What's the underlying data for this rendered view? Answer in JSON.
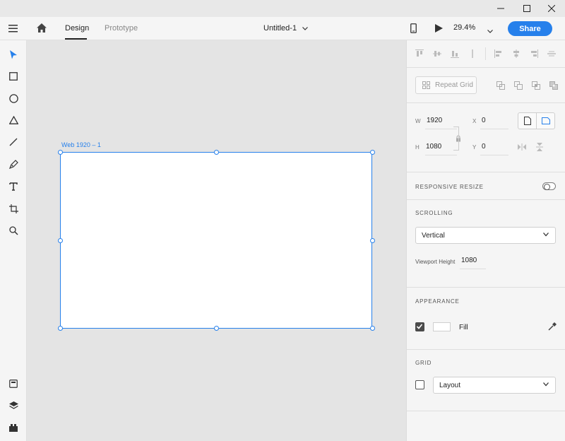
{
  "window": {
    "minimize_icon": "minimize-icon",
    "maximize_icon": "maximize-icon",
    "close_icon": "close-icon"
  },
  "appbar": {
    "menu_icon": "hamburger-icon",
    "home_icon": "home-icon",
    "tabs": [
      {
        "label": "Design",
        "active": true
      },
      {
        "label": "Prototype",
        "active": false
      }
    ],
    "document_title": "Untitled-1",
    "device_preview_icon": "mobile-icon",
    "play_icon": "play-icon",
    "zoom_level": "29.4%",
    "share_label": "Share",
    "accent_color": "#2680eb"
  },
  "toolbar": {
    "tools": [
      {
        "name": "select-tool",
        "icon": "arrow-icon"
      },
      {
        "name": "rectangle-tool",
        "icon": "rectangle-icon"
      },
      {
        "name": "ellipse-tool",
        "icon": "ellipse-icon"
      },
      {
        "name": "polygon-tool",
        "icon": "triangle-icon"
      },
      {
        "name": "line-tool",
        "icon": "line-icon"
      },
      {
        "name": "pen-tool",
        "icon": "pen-icon"
      },
      {
        "name": "text-tool",
        "icon": "text-icon"
      },
      {
        "name": "artboard-tool",
        "icon": "artboard-icon"
      },
      {
        "name": "zoom-tool",
        "icon": "magnifier-icon"
      }
    ],
    "bottom": [
      {
        "name": "document-assets",
        "icon": "assets-icon"
      },
      {
        "name": "layers",
        "icon": "layers-icon"
      },
      {
        "name": "plugins",
        "icon": "plugins-icon"
      }
    ]
  },
  "canvas": {
    "artboard_label": "Web 1920 – 1"
  },
  "panel": {
    "repeat_grid_label": "Repeat Grid",
    "transform": {
      "w_label": "W",
      "w_value": "1920",
      "h_label": "H",
      "h_value": "1080",
      "x_label": "X",
      "x_value": "0",
      "y_label": "Y",
      "y_value": "0"
    },
    "responsive_resize": {
      "title": "RESPONSIVE RESIZE",
      "enabled": false
    },
    "scrolling": {
      "title": "SCROLLING",
      "selected": "Vertical",
      "viewport_label": "Viewport Height",
      "viewport_value": "1080"
    },
    "appearance": {
      "title": "APPEARANCE",
      "fill_label": "Fill",
      "fill_checked": true,
      "fill_color": "#ffffff"
    },
    "grid": {
      "title": "GRID",
      "checked": false,
      "selected": "Layout"
    }
  }
}
